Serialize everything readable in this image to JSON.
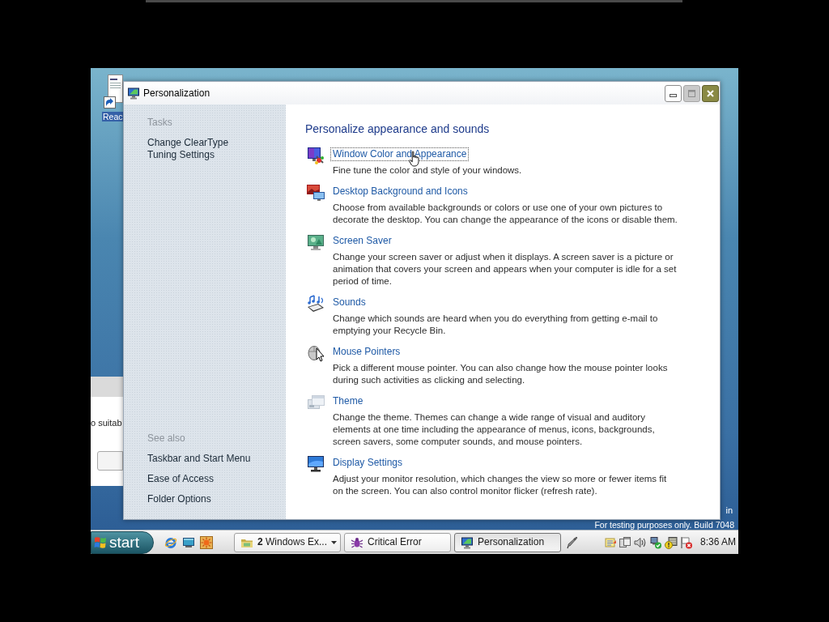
{
  "desktop": {
    "icons": [
      {
        "label": "Reac",
        "selected": true
      }
    ],
    "build_notice": "For testing purposes only. Build 7048",
    "edge_text": "in"
  },
  "background_window": {
    "text": "o suitab"
  },
  "window": {
    "title": "Personalization",
    "controls": [
      {
        "kind": "minimize",
        "disabled": false
      },
      {
        "kind": "maximize",
        "disabled": true
      },
      {
        "kind": "close",
        "disabled": false
      }
    ]
  },
  "sidebar": {
    "sections": [
      {
        "heading": "Tasks",
        "links": [
          "Change ClearType Tuning Settings"
        ]
      },
      {
        "heading": "See also",
        "links": [
          "Taskbar and Start Menu",
          "Ease of Access",
          "Folder Options"
        ]
      }
    ]
  },
  "content": {
    "heading": "Personalize appearance and sounds",
    "items": [
      {
        "title": "Window Color and Appearance",
        "description": "Fine tune the color and style of your windows.",
        "focused": true,
        "hovered": true
      },
      {
        "title": "Desktop Background and Icons",
        "description": "Choose from available backgrounds or colors or use one of your own pictures to decorate the desktop. You can change the appearance of the icons or disable them.",
        "focused": false,
        "hovered": false
      },
      {
        "title": "Screen Saver",
        "description": "Change your screen saver or adjust when it displays. A screen saver is a picture or animation that covers your screen and appears when your computer is idle for a set period of time.",
        "focused": false,
        "hovered": false
      },
      {
        "title": "Sounds",
        "description": "Change which sounds are heard when you do everything from getting e-mail to emptying your Recycle Bin.",
        "focused": false,
        "hovered": false
      },
      {
        "title": "Mouse Pointers",
        "description": "Pick a different mouse pointer. You can also change how the mouse pointer looks during such activities as clicking and selecting.",
        "focused": false,
        "hovered": false
      },
      {
        "title": "Theme",
        "description": "Change the theme. Themes can change a wide range of visual and auditory elements at one time including the appearance of menus, icons, backgrounds, screen savers, some computer sounds, and mouse pointers.",
        "focused": false,
        "hovered": false
      },
      {
        "title": "Display Settings",
        "description": "Adjust your monitor resolution, which changes the view so more or fewer items fit on the screen. You can also control monitor flicker (refresh rate).",
        "focused": false,
        "hovered": false
      }
    ]
  },
  "taskbar": {
    "start_label": "start",
    "tasks": [
      {
        "label": "**2** Windows Ex...",
        "grouped": true,
        "selected": false
      },
      {
        "label": "Critical Error",
        "grouped": false,
        "selected": false
      },
      {
        "label": "Personalization",
        "grouped": false,
        "selected": true
      }
    ],
    "clock": "8:36 AM"
  }
}
